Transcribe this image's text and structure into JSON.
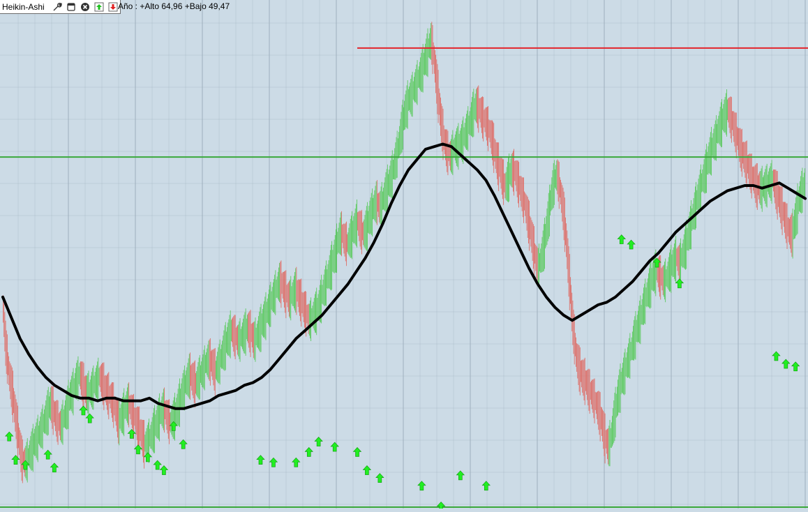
{
  "toolbar": {
    "title": "Heikin-Ashi",
    "buttons": [
      {
        "name": "properties-button",
        "icon": "wrench-icon"
      },
      {
        "name": "window-button",
        "icon": "window-icon"
      },
      {
        "name": "close-button",
        "icon": "close-icon"
      },
      {
        "name": "buy-signal-button",
        "icon": "arrow-up-icon"
      },
      {
        "name": "sell-signal-button",
        "icon": "arrow-down-icon"
      }
    ]
  },
  "info": {
    "label": "Año : +Alto 64,96 +Bajo 49,47"
  },
  "colors": {
    "background": "#ccdbe6",
    "grid": "#9eafbd",
    "bullish": "#4fc850",
    "bearish": "#e0625a",
    "moving_average": "#000000",
    "resistance_line": "#e3242b",
    "channel_line": "#3aa83a",
    "signal_arrow": "#22ee22"
  },
  "chart_data": {
    "type": "line",
    "title": "",
    "xlabel": "",
    "ylabel": "",
    "ylim": [
      48.0,
      67.5
    ],
    "grid": true,
    "legend": "none",
    "series": [
      {
        "role": "heikin-ashi-close",
        "values": [
          55.9,
          54.2,
          53.2,
          52.5,
          51.6,
          50.7,
          49.9,
          49.8,
          50.0,
          50.3,
          50.6,
          50.8,
          51.1,
          51.4,
          51.8,
          52.1,
          51.7,
          51.4,
          51.2,
          51.5,
          51.9,
          52.4,
          52.6,
          53.0,
          53.2,
          52.8,
          52.5,
          52.5,
          52.7,
          52.9,
          53.1,
          52.9,
          52.6,
          52.4,
          52.2,
          51.8,
          51.4,
          51.6,
          51.9,
          52.1,
          51.8,
          51.5,
          51.2,
          50.9,
          50.5,
          50.6,
          50.8,
          51.1,
          51.4,
          51.7,
          51.9,
          51.6,
          51.3,
          51.5,
          51.8,
          52.2,
          52.6,
          52.9,
          53.2,
          53.0,
          52.8,
          53.1,
          53.3,
          53.6,
          53.8,
          53.6,
          53.3,
          53.6,
          53.9,
          54.3,
          54.6,
          54.9,
          54.7,
          54.5,
          54.6,
          54.8,
          55.0,
          54.8,
          54.5,
          54.7,
          55.0,
          55.3,
          55.6,
          55.9,
          56.2,
          56.5,
          56.8,
          56.6,
          56.3,
          56.1,
          56.3,
          56.5,
          56.2,
          55.9,
          55.6,
          55.3,
          55.4,
          55.6,
          55.8,
          56.2,
          56.6,
          57.0,
          57.4,
          57.8,
          58.3,
          58.7,
          58.4,
          58.2,
          58.5,
          58.8,
          59.1,
          58.8,
          58.6,
          58.9,
          59.3,
          59.6,
          59.9,
          59.6,
          59.9,
          60.3,
          60.6,
          61.0,
          61.5,
          62.1,
          62.8,
          63.4,
          63.8,
          64.0,
          64.3,
          64.6,
          64.9,
          65.3,
          65.7,
          66.1,
          65.2,
          64.1,
          63.0,
          62.2,
          61.8,
          61.6,
          61.9,
          62.0,
          62.1,
          62.3,
          62.6,
          62.9,
          63.3,
          63.6,
          63.4,
          63.1,
          62.9,
          62.6,
          62.2,
          61.6,
          61.2,
          60.8,
          60.4,
          60.8,
          61.1,
          61.0,
          60.6,
          60.2,
          59.8,
          59.2,
          58.6,
          57.9,
          57.3,
          57.6,
          58.2,
          59.0,
          59.9,
          60.6,
          60.9,
          60.3,
          59.5,
          58.2,
          56.6,
          55.0,
          53.9,
          53.4,
          53.1,
          52.9,
          52.6,
          52.4,
          52.1,
          51.8,
          51.3,
          50.7,
          50.4,
          50.9,
          51.7,
          52.4,
          52.9,
          53.3,
          53.7,
          54.1,
          54.6,
          55.0,
          55.4,
          55.9,
          56.3,
          56.7,
          57.1,
          57.2,
          57.0,
          56.8,
          56.9,
          57.2,
          57.5,
          57.7,
          57.5,
          57.8,
          58.2,
          58.7,
          59.2,
          59.7,
          60.2,
          60.6,
          61.0,
          61.5,
          61.9,
          62.2,
          62.6,
          62.9,
          63.2,
          63.4,
          63.1,
          62.7,
          62.3,
          61.9,
          61.6,
          61.3,
          61.0,
          60.7,
          60.5,
          60.4,
          60.4,
          60.5,
          60.6,
          60.7,
          60.3,
          59.9,
          59.5,
          59.1,
          58.7,
          58.6,
          59.2,
          59.9,
          60.3,
          60.6
        ]
      },
      {
        "role": "moving-average",
        "values": [
          56.1,
          55.3,
          54.5,
          53.9,
          53.4,
          53.0,
          52.7,
          52.5,
          52.3,
          52.2,
          52.2,
          52.1,
          52.2,
          52.2,
          52.1,
          52.1,
          52.1,
          52.2,
          52.0,
          51.9,
          51.8,
          51.8,
          51.9,
          52.0,
          52.1,
          52.3,
          52.4,
          52.5,
          52.7,
          52.8,
          53.0,
          53.3,
          53.7,
          54.1,
          54.5,
          54.8,
          55.1,
          55.4,
          55.8,
          56.2,
          56.6,
          57.1,
          57.6,
          58.2,
          58.9,
          59.7,
          60.4,
          61.0,
          61.4,
          61.8,
          61.9,
          62.0,
          61.9,
          61.6,
          61.3,
          61.0,
          60.6,
          60.0,
          59.3,
          58.6,
          57.9,
          57.2,
          56.6,
          56.1,
          55.7,
          55.4,
          55.2,
          55.4,
          55.6,
          55.8,
          55.9,
          56.1,
          56.4,
          56.7,
          57.1,
          57.5,
          57.8,
          58.2,
          58.6,
          58.9,
          59.2,
          59.5,
          59.8,
          60.0,
          60.2,
          60.3,
          60.4,
          60.4,
          60.3,
          60.4,
          60.5,
          60.3,
          60.1,
          59.9
        ]
      }
    ],
    "buy_signals": [
      {
        "idx": 2,
        "value": 50.9
      },
      {
        "idx": 4,
        "value": 50.0
      },
      {
        "idx": 7,
        "value": 49.8
      },
      {
        "idx": 14,
        "value": 50.2
      },
      {
        "idx": 16,
        "value": 49.7
      },
      {
        "idx": 25,
        "value": 51.9
      },
      {
        "idx": 27,
        "value": 51.6
      },
      {
        "idx": 40,
        "value": 51.0
      },
      {
        "idx": 42,
        "value": 50.4
      },
      {
        "idx": 45,
        "value": 50.1
      },
      {
        "idx": 48,
        "value": 49.8
      },
      {
        "idx": 50,
        "value": 49.6
      },
      {
        "idx": 53,
        "value": 51.3
      },
      {
        "idx": 56,
        "value": 50.6
      },
      {
        "idx": 80,
        "value": 50.0
      },
      {
        "idx": 84,
        "value": 49.9
      },
      {
        "idx": 91,
        "value": 49.9
      },
      {
        "idx": 95,
        "value": 50.3
      },
      {
        "idx": 98,
        "value": 50.7
      },
      {
        "idx": 103,
        "value": 50.5
      },
      {
        "idx": 110,
        "value": 50.3
      },
      {
        "idx": 113,
        "value": 49.6
      },
      {
        "idx": 117,
        "value": 49.3
      },
      {
        "idx": 130,
        "value": 49.0
      },
      {
        "idx": 136,
        "value": 48.2
      },
      {
        "idx": 142,
        "value": 49.4
      },
      {
        "idx": 150,
        "value": 49.0
      },
      {
        "idx": 192,
        "value": 58.5
      },
      {
        "idx": 195,
        "value": 58.3
      },
      {
        "idx": 203,
        "value": 57.6
      },
      {
        "idx": 210,
        "value": 56.8
      },
      {
        "idx": 240,
        "value": 54.0
      },
      {
        "idx": 243,
        "value": 53.7
      },
      {
        "idx": 246,
        "value": 53.6
      }
    ],
    "horizontal_lines": [
      {
        "role": "resistance",
        "value": 65.7,
        "from_idx": 110,
        "color": "#e3242b"
      },
      {
        "role": "upper-channel",
        "value": 61.5,
        "color": "#3aa83a"
      },
      {
        "role": "lower-channel",
        "value": 48.0,
        "color": "#3aa83a"
      }
    ]
  }
}
